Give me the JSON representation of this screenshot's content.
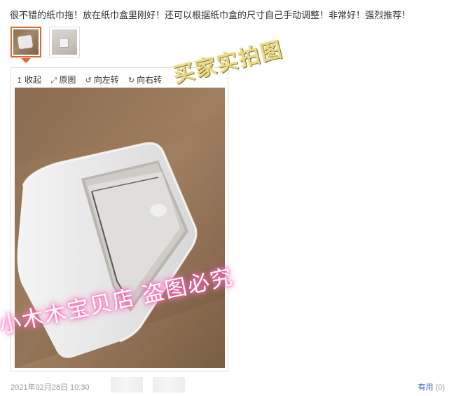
{
  "review": {
    "text": "很不错的纸巾拖！放在纸巾盒里刚好！还可以根据纸巾盒的尺寸自己手动调整！非常好！强烈推荐！",
    "date": "2021年02月28日 10:30"
  },
  "thumbnails": [
    {
      "selected": true
    },
    {
      "selected": false
    }
  ],
  "toolbar": {
    "collapse": "收起",
    "original": "原图",
    "rotate_left": "向左转",
    "rotate_right": "向右转"
  },
  "watermarks": {
    "top": "买家实拍图",
    "bottom": "小木木宝贝店  盗图必究"
  },
  "helpful": {
    "label": "有用",
    "count": "(0)"
  },
  "colors": {
    "accent": "#e5662e",
    "link": "#3366cc",
    "muted": "#999999"
  }
}
